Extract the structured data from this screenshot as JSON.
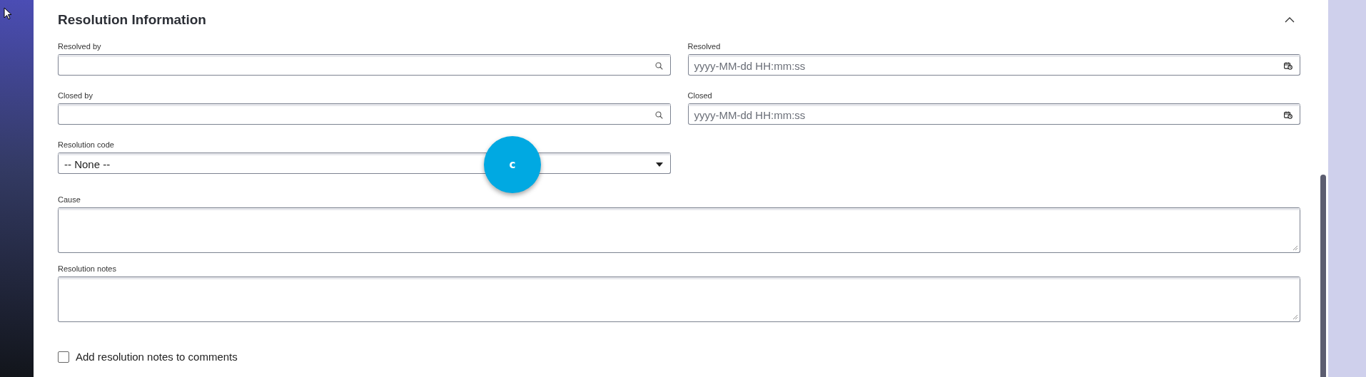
{
  "section": {
    "title": "Resolution Information",
    "expanded": true
  },
  "rows": [
    [
      {
        "kind": "lookup",
        "label": "Resolved by"
      },
      {
        "kind": "datetime",
        "label": "Resolved",
        "placeholder": "yyyy-MM-dd HH:mm:ss"
      }
    ],
    [
      {
        "kind": "lookup",
        "label": "Closed by"
      },
      {
        "kind": "datetime",
        "label": "Closed",
        "placeholder": "yyyy-MM-dd HH:mm:ss"
      }
    ],
    [
      {
        "kind": "choice",
        "label": "Resolution code",
        "value": "-- None --"
      }
    ],
    [
      {
        "kind": "textarea",
        "label": "Cause"
      }
    ],
    [
      {
        "kind": "textarea",
        "label": "Resolution notes"
      }
    ]
  ],
  "checkbox": {
    "label": "Add resolution notes to comments",
    "checked": false
  },
  "marker": {
    "label": "c"
  }
}
